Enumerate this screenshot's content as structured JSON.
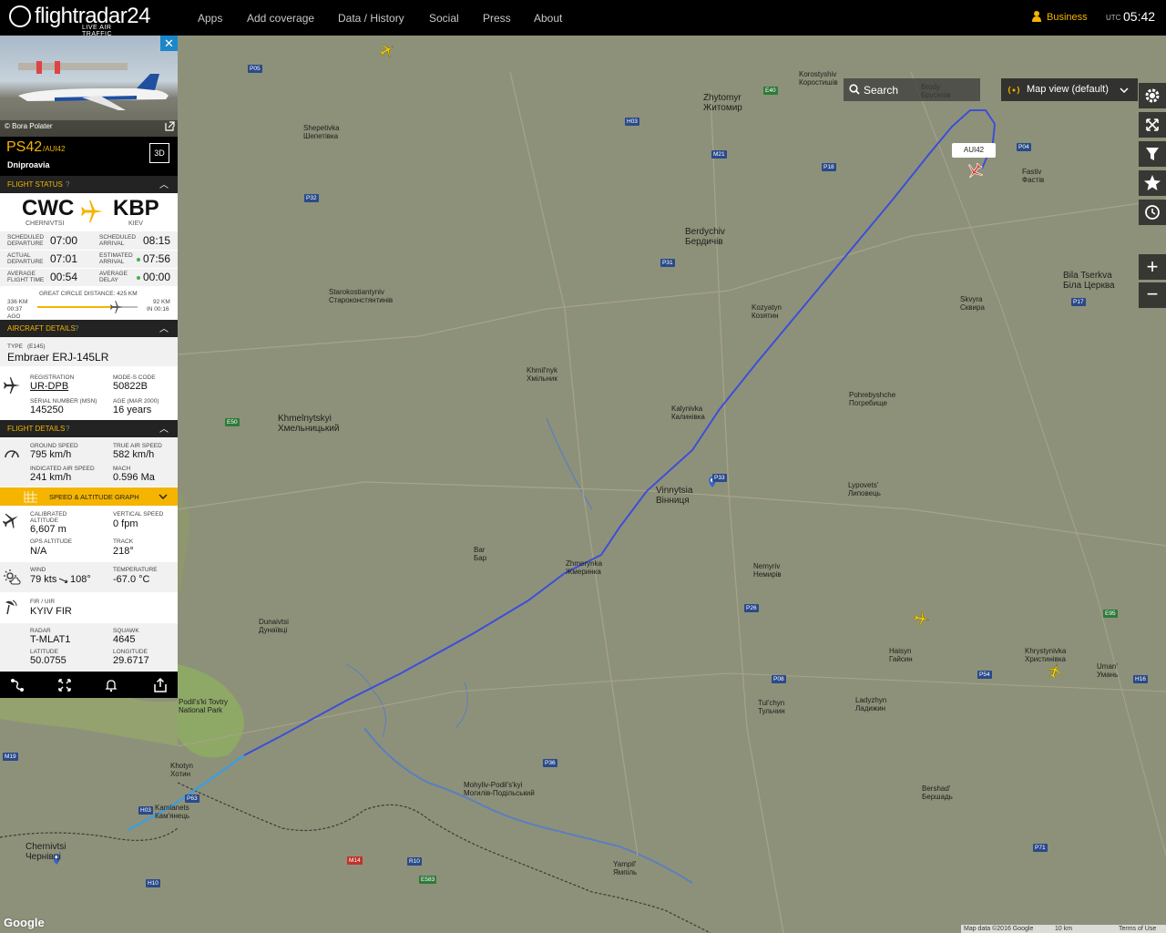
{
  "nav": {
    "logo_name": "flightradar24",
    "logo_tagline": "LIVE AIR TRAFFIC",
    "items": [
      "Apps",
      "Add coverage",
      "Data / History",
      "Social",
      "Press",
      "About"
    ],
    "business": "Business",
    "utc_label": "UTC",
    "clock": "05:42"
  },
  "map": {
    "search_label": "Search",
    "view_label": "Map view (default)",
    "zoom_in": "+",
    "zoom_out": "−",
    "flight_tag": "AUI42",
    "attribution": "Map data ©2016 Google",
    "scale": "10 km",
    "terms": "Terms of Use",
    "google": "Google",
    "places": [
      {
        "name": "Zhytomyr\nЖитомир",
        "big": true
      },
      {
        "name": "Berdychiv\nБердичів",
        "big": true
      },
      {
        "name": "Vinnytsia\nВінниця",
        "big": true
      },
      {
        "name": "Khmelnytskyi\nХмельницький",
        "big": true
      },
      {
        "name": "Bila Tserkva\nБіла Церква",
        "big": true
      },
      {
        "name": "Chernivtsi\nЧернівці",
        "big": true
      },
      {
        "name": "Fastiv\nФастів"
      },
      {
        "name": "Shepetivka\nШепетівка"
      },
      {
        "name": "Starokostiantyniv\nСтароконстянтинів"
      },
      {
        "name": "Khmil'nyk\nХмільник"
      },
      {
        "name": "Kalynivka\nКалинівка"
      },
      {
        "name": "Koziatyn\nКозятин"
      },
      {
        "name": "Zhmerynka\nЖмеринка"
      },
      {
        "name": "Haisyn\nГайсин"
      },
      {
        "name": "Uman'\nУмань"
      },
      {
        "name": "Khotyn\nХотин"
      },
      {
        "name": "Skvyra\nСквира"
      },
      {
        "name": "Bar\nБар"
      },
      {
        "name": "Mohyliv-Podil's'kyi\nМогилів-Подільський"
      },
      {
        "name": "Tul'chyn\nТульчин"
      },
      {
        "name": "Ladyzhyn\nЛадижин"
      },
      {
        "name": "Pohrebyshche\nПогребище"
      },
      {
        "name": "Lypovets'\nЛиповець"
      },
      {
        "name": "Nemyriv\nНемирів"
      },
      {
        "name": "Brody\nБрусилів"
      },
      {
        "name": "Korostyshiv\nКоростишів"
      },
      {
        "name": "Dunaivtsi\nДунаївці"
      },
      {
        "name": "Kamianets\nКам'янець"
      },
      {
        "name": "Yampil'\nЯмпіль"
      },
      {
        "name": "Bershad'\nБершадь"
      },
      {
        "name": "Khrystynivka\nХристинівка"
      },
      {
        "name": "Podil's'ki Tovtry\nNational Park"
      }
    ],
    "roads": [
      "E40",
      "M21",
      "P05",
      "P32",
      "H03",
      "M12",
      "E50",
      "P31",
      "P33",
      "P18",
      "E95",
      "P04",
      "M05",
      "P17",
      "P26",
      "M14",
      "H02",
      "R10",
      "P63",
      "H10",
      "M19",
      "E583",
      "M15",
      "P08",
      "E95",
      "P54",
      "H16",
      "P36",
      "P06",
      "P71"
    ]
  },
  "panel": {
    "photo_credit": "© Bora Polater",
    "callsign": "PS42",
    "flight_id": "/AUI42",
    "airline": "Dniproavia",
    "btn_3d": "3D",
    "flight_status_title": "FLIGHT STATUS",
    "origin_code": "CWC",
    "origin_city": "CHERNIVTSI",
    "dest_code": "KBP",
    "dest_city": "KIEV",
    "times": [
      {
        "l1": "SCHEDULED",
        "l2": "DEPARTURE",
        "v1": "07:00",
        "l3": "SCHEDULED",
        "l4": "ARRIVAL",
        "v2": "08:15"
      },
      {
        "l1": "ACTUAL",
        "l2": "DEPARTURE",
        "v1": "07:01",
        "l3": "ESTIMATED",
        "l4": "ARRIVAL",
        "v2": "07:56"
      },
      {
        "l1": "AVERAGE",
        "l2": "FLIGHT TIME",
        "v1": "00:54",
        "l3": "AVERAGE",
        "l4": "DELAY",
        "v2": "00:00"
      }
    ],
    "distance_label": "GREAT CIRCLE DISTANCE: 425 KM",
    "dist_left_km": "336 KM",
    "dist_left_time": "00:37",
    "dist_left_ago": "AGO",
    "dist_right_km": "92 KM",
    "dist_right_time": "IN 00:16",
    "progress": 0.79,
    "aircraft_title": "AIRCRAFT DETAILS",
    "type_label": "TYPE",
    "type_code": "(E145)",
    "type_value": "Embraer ERJ-145LR",
    "registration_label": "REGISTRATION",
    "registration": "UR-DPB",
    "modes_label": "MODE-S CODE",
    "modes": "50822B",
    "serial_label": "SERIAL NUMBER (MSN)",
    "serial": "145250",
    "age_label": "AGE (MAR 2000)",
    "age": "16 years",
    "flight_details_title": "FLIGHT DETAILS",
    "ground_speed_label": "GROUND SPEED",
    "ground_speed": "795 km/h",
    "tas_label": "TRUE AIR SPEED",
    "tas": "582 km/h",
    "ias_label": "INDICATED AIR SPEED",
    "ias": "241 km/h",
    "mach_label": "MACH",
    "mach": "0.596 Ma",
    "graph_label": "SPEED & ALTITUDE GRAPH",
    "cal_alt_label": "CALIBRATED ALTITUDE",
    "cal_alt": "6,607 m",
    "vs_label": "VERTICAL SPEED",
    "vs": "0 fpm",
    "gps_alt_label": "GPS ALTITUDE",
    "gps_alt": "N/A",
    "track_label": "TRACK",
    "track": "218°",
    "wind_label": "WIND",
    "wind": "79 kts",
    "wind_dir": "108°",
    "temp_label": "TEMPERATURE",
    "temp": "-67.0 °C",
    "fir_label": "FIR / UIR",
    "fir": "KYIV FIR",
    "radar_label": "RADAR",
    "radar": "T-MLAT1",
    "squawk_label": "SQUAWK",
    "squawk": "4645",
    "lat_label": "LATITUDE",
    "lat": "50.0755",
    "lon_label": "LONGITUDE",
    "lon": "29.6717"
  },
  "colors": {
    "accent": "#f5b400",
    "track": "#3b4fd8",
    "track_light": "#39a3e6",
    "bar": "#000000",
    "map": "#8e9179"
  }
}
